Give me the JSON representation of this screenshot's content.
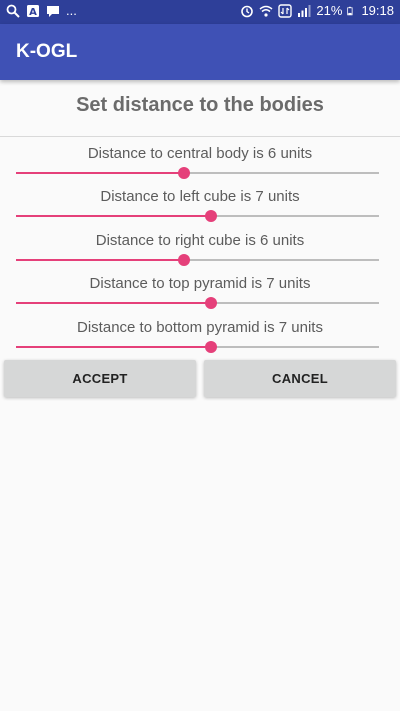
{
  "status_bar": {
    "left_icons": [
      "search-icon",
      "font-icon",
      "message-icon"
    ],
    "overflow": "...",
    "battery_percent": "21%",
    "time": "19:18",
    "right_icons": [
      "alarm-icon",
      "wifi-icon",
      "data-icon",
      "signal-icon",
      "battery-icon"
    ]
  },
  "app_bar": {
    "title": "K-OGL"
  },
  "dialog": {
    "title": "Set distance to the bodies",
    "sliders": [
      {
        "label": "Distance to central body is 6  units",
        "value": 6
      },
      {
        "label": "Distance to left cube is 7  units",
        "value": 7
      },
      {
        "label": "Distance to right cube is 6  units",
        "value": 6
      },
      {
        "label": "Distance to top pyramid is 7  units",
        "value": 7
      },
      {
        "label": "Distance to bottom pyramid is 7  units",
        "value": 7
      }
    ],
    "slider_min": 0,
    "slider_max": 13,
    "accept_label": "ACCEPT",
    "cancel_label": "CANCEL"
  },
  "colors": {
    "status_bar": "#2e3f99",
    "app_bar": "#3f51b5",
    "accent": "#e5407a",
    "button": "#d6d7d7"
  }
}
